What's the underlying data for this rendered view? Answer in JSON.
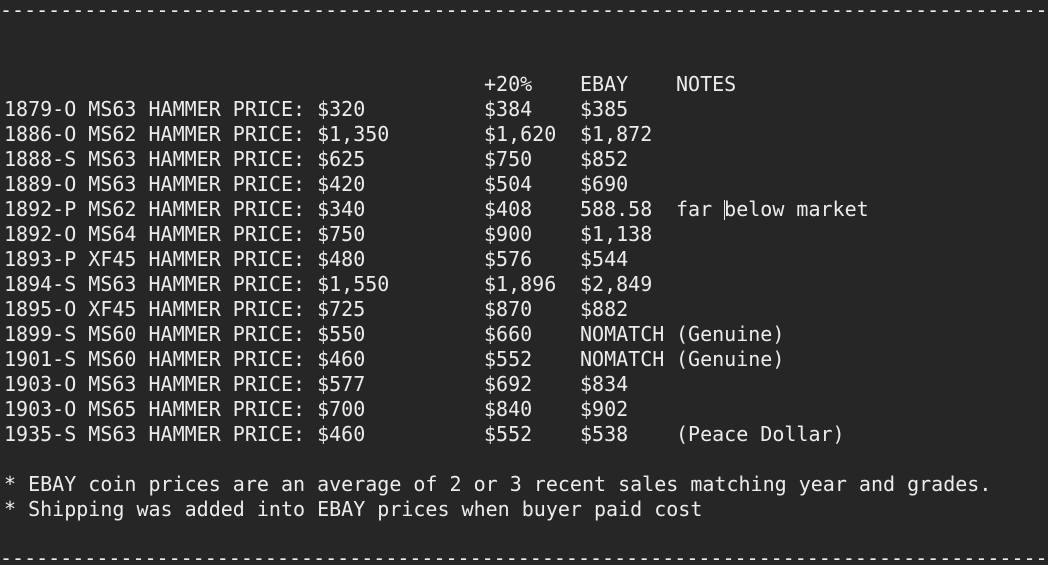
{
  "divider": "--------------------------------------------------------------------------------------------------------------",
  "headers": {
    "plus20": "+20%",
    "ebay": "EBAY",
    "notes": "NOTES"
  },
  "rows": [
    {
      "coin": "1879-O MS63 HAMMER PRICE: $320",
      "plus20": "$384",
      "ebay": "$385",
      "notes": ""
    },
    {
      "coin": "1886-O MS62 HAMMER PRICE: $1,350",
      "plus20": "$1,620",
      "ebay": "$1,872",
      "notes": ""
    },
    {
      "coin": "1888-S MS63 HAMMER PRICE: $625",
      "plus20": "$750",
      "ebay": "$852",
      "notes": ""
    },
    {
      "coin": "1889-O MS63 HAMMER PRICE: $420",
      "plus20": "$504",
      "ebay": "$690",
      "notes": ""
    },
    {
      "coin": "1892-P MS62 HAMMER PRICE: $340",
      "plus20": "$408",
      "ebay": "588.58",
      "notes": "far below market"
    },
    {
      "coin": "1892-O MS64 HAMMER PRICE: $750",
      "plus20": "$900",
      "ebay": "$1,138",
      "notes": ""
    },
    {
      "coin": "1893-P XF45 HAMMER PRICE: $480",
      "plus20": "$576",
      "ebay": "$544",
      "notes": ""
    },
    {
      "coin": "1894-S MS63 HAMMER PRICE: $1,550",
      "plus20": "$1,896",
      "ebay": "$2,849",
      "notes": ""
    },
    {
      "coin": "1895-O XF45 HAMMER PRICE: $725",
      "plus20": "$870",
      "ebay": "$882",
      "notes": ""
    },
    {
      "coin": "1899-S MS60 HAMMER PRICE: $550",
      "plus20": "$660",
      "ebay": "NOMATCH",
      "notes": "(Genuine)"
    },
    {
      "coin": "1901-S MS60 HAMMER PRICE: $460",
      "plus20": "$552",
      "ebay": "NOMATCH",
      "notes": "(Genuine)"
    },
    {
      "coin": "1903-O MS63 HAMMER PRICE: $577",
      "plus20": "$692",
      "ebay": "$834",
      "notes": ""
    },
    {
      "coin": "1903-O MS65 HAMMER PRICE: $700",
      "plus20": "$840",
      "ebay": "$902",
      "notes": ""
    },
    {
      "coin": "1935-S MS63 HAMMER PRICE: $460",
      "plus20": "$552",
      "ebay": "$538",
      "notes": "(Peace Dollar)"
    }
  ],
  "footnotes": [
    "* EBAY coin prices are an average of 2 or 3 recent sales matching year and grades.",
    "* Shipping was added into EBAY prices when buyer paid cost"
  ],
  "colors": {
    "background": "#262626",
    "text": "#ececec"
  }
}
